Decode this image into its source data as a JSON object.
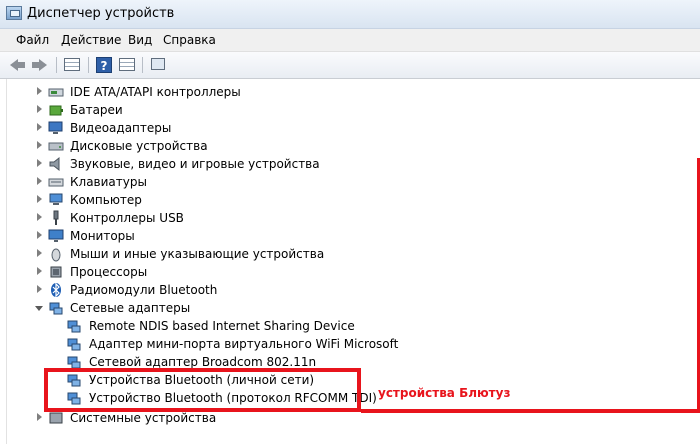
{
  "window": {
    "title": "Диспетчер устройств"
  },
  "menu": [
    "Файл",
    "Действие",
    "Вид",
    "Справка"
  ],
  "tree": {
    "categories": [
      {
        "label": "IDE ATA/ATAPI контроллеры",
        "icon": "ide-controller-icon"
      },
      {
        "label": "Батареи",
        "icon": "battery-icon"
      },
      {
        "label": "Видеоадаптеры",
        "icon": "display-adapter-icon"
      },
      {
        "label": "Дисковые устройства",
        "icon": "disk-drive-icon"
      },
      {
        "label": "Звуковые, видео и игровые устройства",
        "icon": "speaker-icon"
      },
      {
        "label": "Клавиатуры",
        "icon": "keyboard-icon"
      },
      {
        "label": "Компьютер",
        "icon": "computer-icon"
      },
      {
        "label": "Контроллеры USB",
        "icon": "usb-icon"
      },
      {
        "label": "Мониторы",
        "icon": "monitor-icon"
      },
      {
        "label": "Мыши и иные указывающие устройства",
        "icon": "mouse-icon"
      },
      {
        "label": "Процессоры",
        "icon": "processor-icon"
      },
      {
        "label": "Радиомодули Bluetooth",
        "icon": "bluetooth-icon"
      },
      {
        "label": "Сетевые адаптеры",
        "icon": "network-adapter-icon"
      }
    ],
    "network_children": [
      "Remote NDIS based Internet Sharing Device",
      "Адаптер мини-порта виртуального WiFi Microsoft",
      "Сетевой адаптер Broadcom 802.11n",
      "Устройства Bluetooth (личной сети)",
      "Устройство Bluetooth (протокол RFCOMM TDI)"
    ],
    "partial_next": "Системные устройства"
  },
  "annotation": {
    "text": "устройства Блютуз",
    "color": "#e8141c"
  }
}
